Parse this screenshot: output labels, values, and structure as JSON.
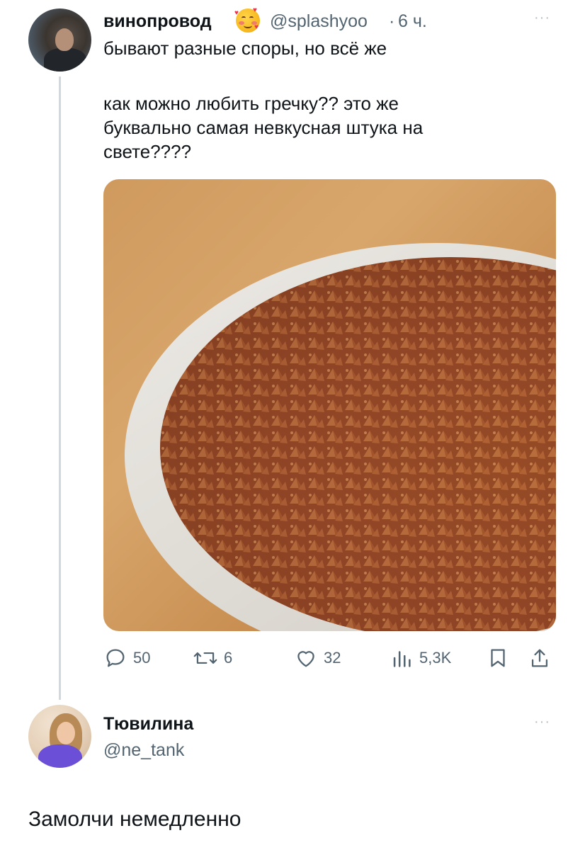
{
  "post": {
    "author_name": "винопровод",
    "author_handle": "@splashyoo",
    "separator": "·",
    "time": "6 ч.",
    "more": "···",
    "text_line1": "бывают разные споры, но всё же",
    "text_rest": "как можно любить гречку?? это же\nбуквально самая невкусная штука на\nсвете????",
    "image_alt": "buckwheat in a white bowl",
    "emoji_icon": "smiling-face-with-hearts-icon",
    "actions": {
      "replies": "50",
      "reposts": "6",
      "likes": "32",
      "views": "5,3K"
    }
  },
  "reply": {
    "author_name": "Тювилина",
    "author_handle": "@ne_tank",
    "more": "···",
    "text": "Замолчи немедленно"
  },
  "colors": {
    "text": "#0f1419",
    "muted": "#536471",
    "thread_line": "#cfd9de"
  }
}
